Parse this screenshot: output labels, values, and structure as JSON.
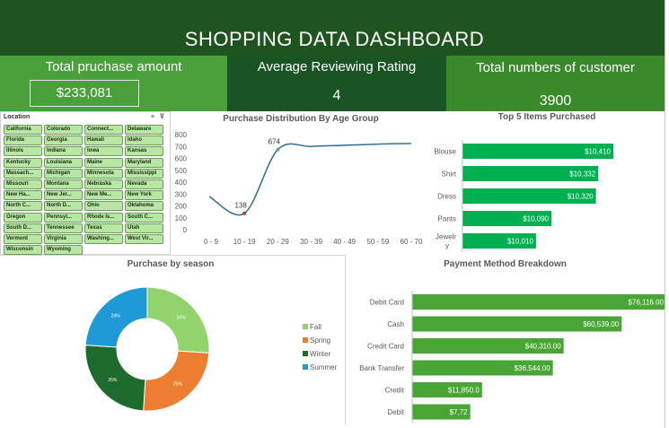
{
  "title": "SHOPPING DATA DASHBOARD",
  "kpis": {
    "total_purchase": {
      "label": "Total pruchase amount",
      "value": "$233,081"
    },
    "avg_rating": {
      "label": "Average Reviewing Rating",
      "value": "4"
    },
    "customers": {
      "label": "Total numbers of customer",
      "value": "3900"
    }
  },
  "slicer": {
    "title": "Location",
    "icons": "≡ ⊽",
    "items": [
      "California",
      "Colorado",
      "Connect...",
      "Delaware",
      "Florida",
      "Georgia",
      "Hawaii",
      "Idaho",
      "Illinois",
      "Indiana",
      "Iowa",
      "Kansas",
      "Kentucky",
      "Louisiana",
      "Maine",
      "Maryland",
      "Massach...",
      "Michigan",
      "Minnesota",
      "Mississippi",
      "Missouri",
      "Montana",
      "Nebraska",
      "Nevada",
      "New Ha...",
      "New Jer...",
      "New Me...",
      "New York",
      "North C...",
      "North D...",
      "Ohio",
      "Oklahoma",
      "Oregon",
      "Pennsyl...",
      "Rhode Is...",
      "South C...",
      "South D...",
      "Tennessee",
      "Texas",
      "Utah",
      "Vermont",
      "Virginia",
      "Washing...",
      "West Vir...",
      "Wisconsin",
      "Wyoming"
    ]
  },
  "chart_data": [
    {
      "type": "line",
      "title": "Purchase Distribution By Age Group",
      "categories": [
        "0 - 9",
        "10 - 19",
        "20 - 29",
        "30 - 39",
        "40 - 49",
        "50 - 59",
        "60 - 70"
      ],
      "values": [
        null,
        138,
        674,
        700,
        710,
        720,
        725
      ],
      "pre_point": 280,
      "ylim": [
        0,
        800
      ],
      "yticks": [
        0,
        100,
        200,
        300,
        400,
        500,
        600,
        700,
        800
      ],
      "labeled_points": [
        {
          "category": "10 - 19",
          "label": "138"
        },
        {
          "category": "20 - 29",
          "label": "674"
        }
      ],
      "color": "#2e6d8e"
    },
    {
      "type": "bar",
      "title": "Top 5 Items Purchased",
      "categories": [
        "Blouse",
        "Shirt",
        "Dress",
        "Pants",
        "Jewelry"
      ],
      "values": [
        10410,
        10332,
        10320,
        10090,
        10010
      ],
      "labels": [
        "$10,410",
        "$10,332",
        "$10,320",
        "$10,090",
        "$10,010"
      ],
      "color": "#00b050"
    },
    {
      "type": "pie",
      "title": "Purchase by season",
      "categories": [
        "Fall",
        "Spring",
        "Winter",
        "Summer"
      ],
      "values": [
        26,
        25,
        25,
        24
      ],
      "labels": [
        "26%",
        "25%",
        "25%",
        "24%"
      ],
      "colors": [
        "#92d36e",
        "#ed7d31",
        "#1e6b2e",
        "#1f9ad6"
      ]
    },
    {
      "type": "bar",
      "title": "Payment Method Breakdown",
      "categories": [
        "Debit Card",
        "Cash",
        "Credit Card",
        "Bank Transfer",
        "Credit",
        "Debit"
      ],
      "values": [
        76116,
        60539,
        40310,
        36544,
        11850,
        7720
      ],
      "labels": [
        "$76,116.00",
        "$60,539.00",
        "$40,310.00",
        "$36,544.00",
        "$11,850.0",
        "$7,72"
      ],
      "color": "#4aa537"
    }
  ]
}
